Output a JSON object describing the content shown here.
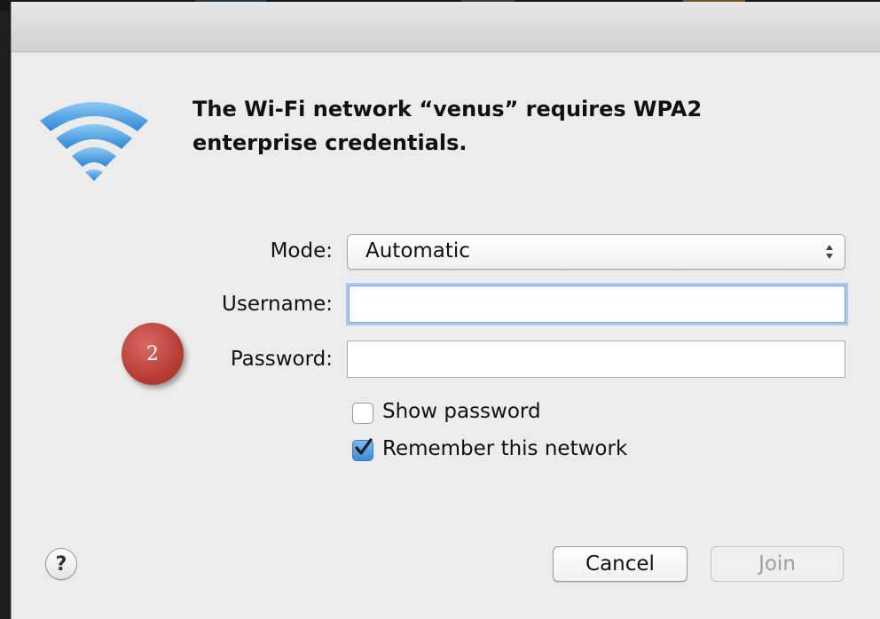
{
  "dialog": {
    "message": "The Wi-Fi network “venus” requires WPA2 enterprise credentials.",
    "icon": "wifi-icon"
  },
  "form": {
    "mode_label": "Mode:",
    "mode_value": "Automatic",
    "username_label": "Username:",
    "username_value": "",
    "password_label": "Password:",
    "password_value": ""
  },
  "options": {
    "show_password_label": "Show password",
    "show_password_checked": false,
    "remember_label": "Remember this network",
    "remember_checked": true
  },
  "annotation": {
    "step": "2"
  },
  "buttons": {
    "help": "?",
    "cancel": "Cancel",
    "join": "Join"
  },
  "colors": {
    "accent": "#3c8bdc",
    "badge": "#b2372f",
    "wifi": "#4fa3ea"
  }
}
